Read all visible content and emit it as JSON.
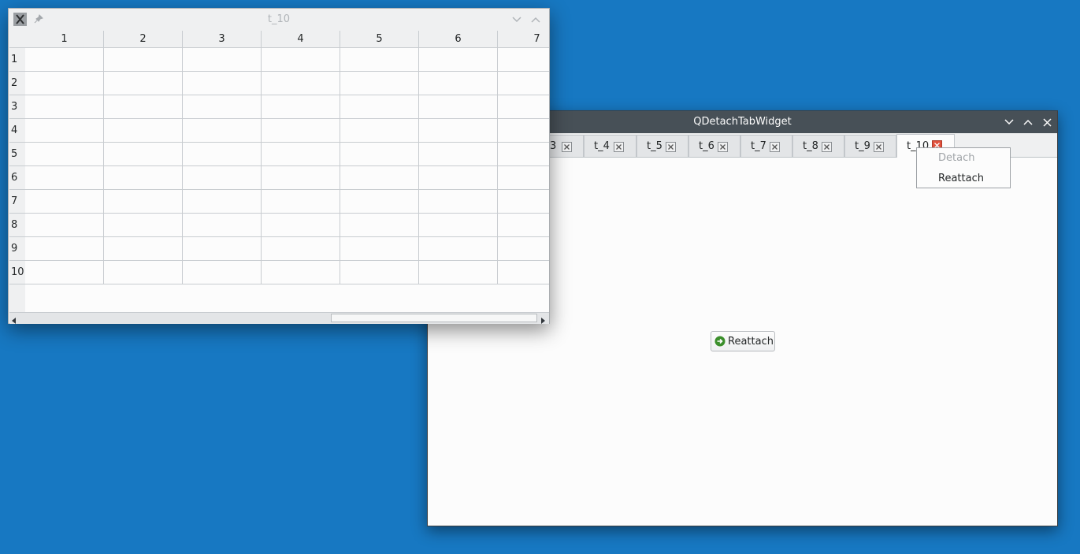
{
  "main_window": {
    "title": "QDetachTabWidget",
    "tabs": [
      {
        "label": "3"
      },
      {
        "label": "t_4"
      },
      {
        "label": "t_5"
      },
      {
        "label": "t_6"
      },
      {
        "label": "t_7"
      },
      {
        "label": "t_8"
      },
      {
        "label": "t_9"
      },
      {
        "label": "t_10",
        "active": true
      }
    ],
    "reattach_button_label": "Reattach"
  },
  "context_menu": {
    "items": [
      {
        "label": "Detach",
        "enabled": false
      },
      {
        "label": "Reattach",
        "enabled": true
      }
    ]
  },
  "detached_window": {
    "title": "t_10",
    "table": {
      "columns": [
        "1",
        "2",
        "3",
        "4",
        "5",
        "6",
        "7"
      ],
      "rows": [
        "1",
        "2",
        "3",
        "4",
        "5",
        "6",
        "7",
        "8",
        "9",
        "10"
      ]
    }
  },
  "colors": {
    "desktop": "#1778c2",
    "titlebar_active": "#475057",
    "close_active": "#e0503c",
    "reattach_icon": "#3b8f2b"
  },
  "icons": {
    "app": "x-app-icon",
    "pin": "pin-icon",
    "minimize": "chevron-down-icon",
    "maximize": "chevron-up-icon",
    "close": "close-icon",
    "tab_close": "tab-close-icon",
    "reattach": "arrow-right-circle-icon"
  }
}
